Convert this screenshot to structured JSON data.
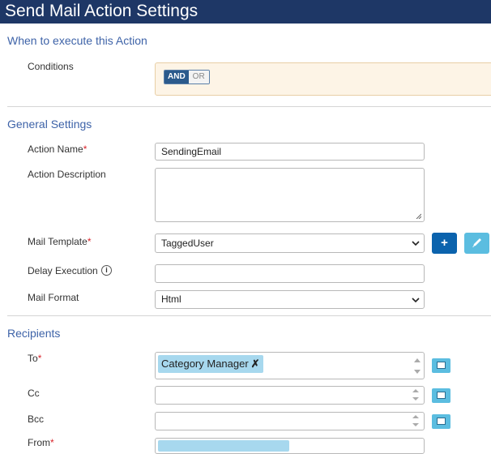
{
  "window": {
    "title": "Send Mail Action Settings"
  },
  "sections": {
    "when": {
      "title": "When to execute this Action"
    },
    "general": {
      "title": "General Settings"
    },
    "recipients": {
      "title": "Recipients"
    }
  },
  "conditions": {
    "label": "Conditions",
    "toggle_and": "AND",
    "toggle_or": "OR",
    "selected": "AND"
  },
  "action_name": {
    "label": "Action Name",
    "required_mark": "*",
    "value": "SendingEmail"
  },
  "action_description": {
    "label": "Action Description",
    "value": ""
  },
  "mail_template": {
    "label": "Mail Template",
    "required_mark": "*",
    "value": "TaggedUser",
    "add_label": "+"
  },
  "delay_execution": {
    "label": "Delay Execution",
    "info_glyph": "i",
    "value": ""
  },
  "mail_format": {
    "label": "Mail Format",
    "value": "Html"
  },
  "to": {
    "label": "To",
    "required_mark": "*",
    "tags": [
      "Category Manager"
    ],
    "remove_glyph": "✗"
  },
  "cc": {
    "label": "Cc",
    "value": ""
  },
  "bcc": {
    "label": "Bcc",
    "value": ""
  },
  "from": {
    "label": "From",
    "required_mark": "*"
  },
  "colors": {
    "titlebar": "#1e3766",
    "section_title": "#3e63a8",
    "primary_button": "#0b63ad",
    "info_button": "#5bbde0",
    "required": "#d9242b",
    "tag": "#a7d8ee"
  }
}
